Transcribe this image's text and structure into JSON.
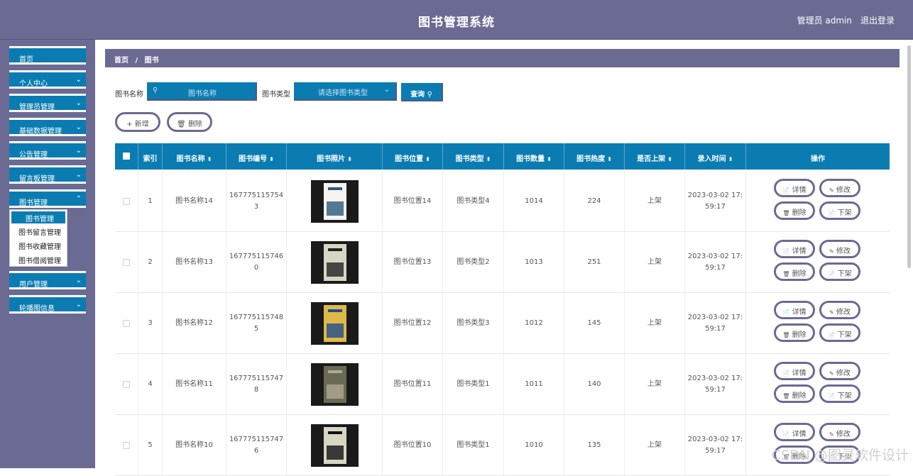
{
  "header": {
    "title": "图书管理系统",
    "admin_label": "管理员 admin",
    "logout": "退出登录"
  },
  "sidebar": {
    "items": [
      {
        "label": "首页",
        "has_arrow": false
      },
      {
        "label": "个人中心",
        "has_arrow": true
      },
      {
        "label": "管理员管理",
        "has_arrow": true
      },
      {
        "label": "基础数据管理",
        "has_arrow": true
      },
      {
        "label": "公告管理",
        "has_arrow": true
      },
      {
        "label": "留言板管理",
        "has_arrow": true
      },
      {
        "label": "图书管理",
        "has_arrow": true
      },
      {
        "label": "用户管理",
        "has_arrow": true
      },
      {
        "label": "轮播图信息",
        "has_arrow": true
      }
    ],
    "submenu": [
      "图书管理",
      "图书留言管理",
      "图书收藏管理",
      "图书借阅管理"
    ]
  },
  "breadcrumb": {
    "home": "首页",
    "sep": "/",
    "current": "图书"
  },
  "search": {
    "name_label": "图书名称",
    "name_placeholder": "图书名称",
    "type_label": "图书类型",
    "type_placeholder": "请选择图书类型",
    "query_button": "查询"
  },
  "actions": {
    "add": "新增",
    "delete": "删除"
  },
  "table": {
    "headers": [
      "索引",
      "图书名称",
      "图书编号",
      "图书照片",
      "图书位置",
      "图书类型",
      "图书数量",
      "图书热度",
      "是否上架",
      "录入时间",
      "操作"
    ],
    "row_buttons": {
      "detail": "详情",
      "edit": "修改",
      "delete": "删除",
      "offshelf": "下架"
    },
    "rows": [
      {
        "index": "1",
        "name": "图书名称14",
        "code_1": "167775115754",
        "code_2": "3",
        "position": "图书位置14",
        "type": "图书类型4",
        "count": "1014",
        "heat": "224",
        "shelf": "上架",
        "time_1": "2023-03-02 17:",
        "time_2": "59:17"
      },
      {
        "index": "2",
        "name": "图书名称13",
        "code_1": "167775115746",
        "code_2": "0",
        "position": "图书位置13",
        "type": "图书类型2",
        "count": "1013",
        "heat": "251",
        "shelf": "上架",
        "time_1": "2023-03-02 17:",
        "time_2": "59:17"
      },
      {
        "index": "3",
        "name": "图书名称12",
        "code_1": "167775115748",
        "code_2": "5",
        "position": "图书位置12",
        "type": "图书类型3",
        "count": "1012",
        "heat": "145",
        "shelf": "上架",
        "time_1": "2023-03-02 17:",
        "time_2": "59:17"
      },
      {
        "index": "4",
        "name": "图书名称11",
        "code_1": "167775115747",
        "code_2": "8",
        "position": "图书位置11",
        "type": "图书类型1",
        "count": "1011",
        "heat": "140",
        "shelf": "上架",
        "time_1": "2023-03-02 17:",
        "time_2": "59:17"
      },
      {
        "index": "5",
        "name": "图书名称10",
        "code_1": "167775115747",
        "code_2": "6",
        "position": "图书位置10",
        "type": "图书类型1",
        "count": "1010",
        "heat": "135",
        "shelf": "上架",
        "time_1": "2023-03-02 17:",
        "time_2": "59:17"
      }
    ]
  },
  "watermark": "CSDN @图灵软件设计",
  "colors": {
    "header": "#6b6a93",
    "primary": "#0a7cb2"
  }
}
